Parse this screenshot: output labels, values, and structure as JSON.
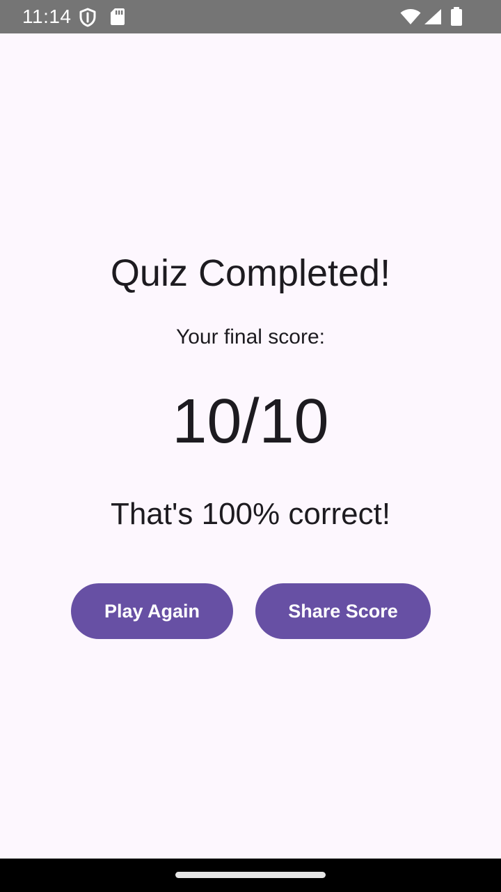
{
  "status_bar": {
    "time": "11:14",
    "icons": [
      "shield-icon",
      "sd-card-icon",
      "wifi-icon",
      "signal-icon",
      "battery-icon"
    ]
  },
  "quiz_result": {
    "title": "Quiz Completed!",
    "score_label": "Your final score:",
    "score": "10/10",
    "percent_text": "That's 100% correct!"
  },
  "actions": {
    "play_again_label": "Play Again",
    "share_score_label": "Share Score"
  },
  "colors": {
    "background": "#fdf7fe",
    "primary": "#6750a4",
    "on_primary": "#ffffff",
    "status_bar": "#757575",
    "nav_bar": "#000000"
  }
}
